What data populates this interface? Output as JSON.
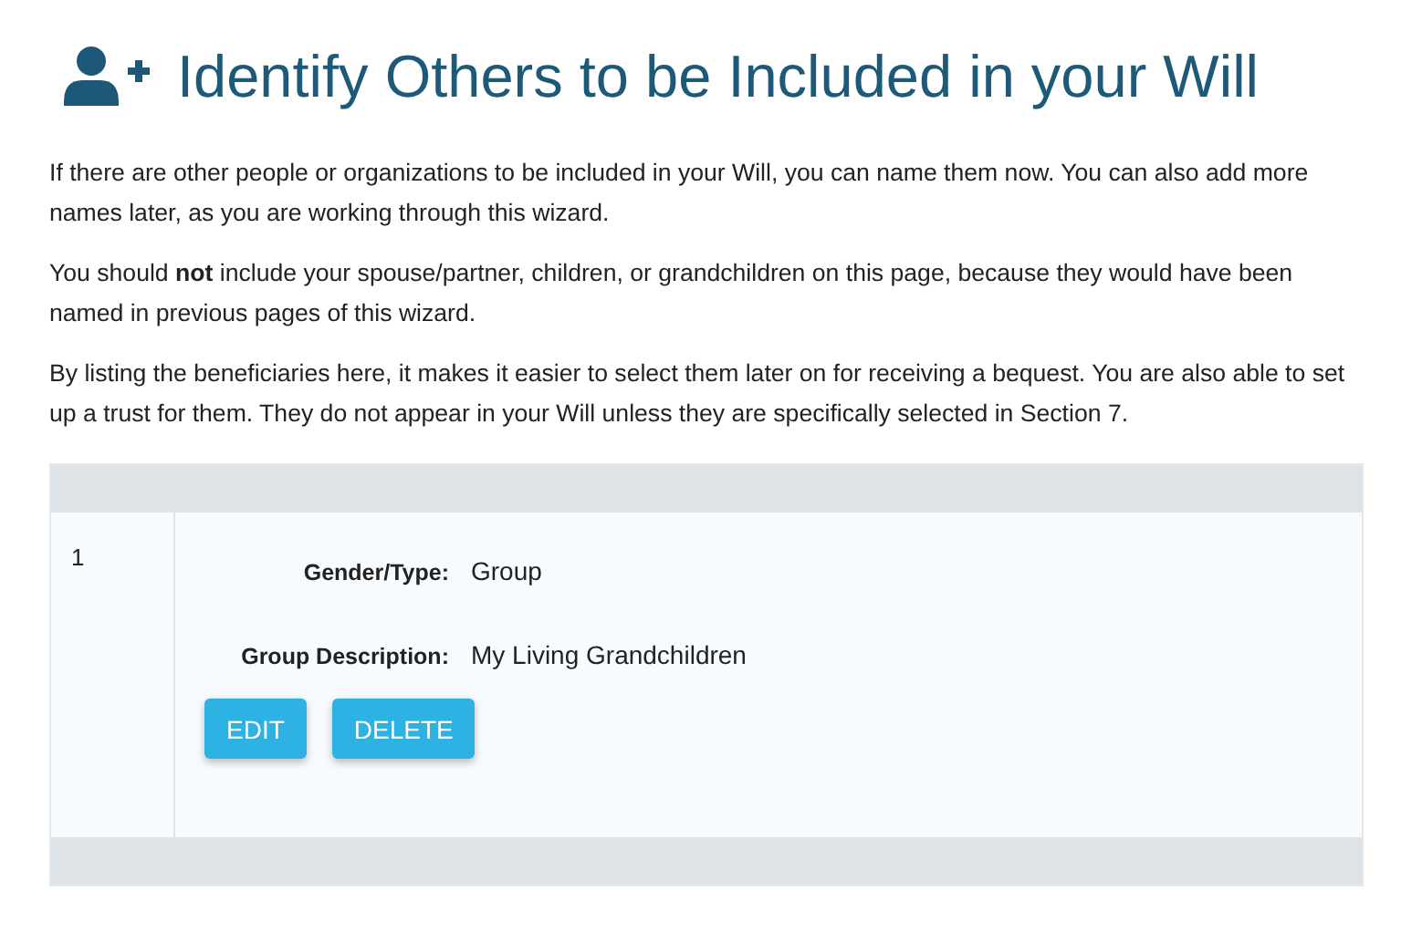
{
  "title": "Identify Others to be Included in your Will",
  "paragraphs": [
    "If there are other people or organizations to be included in your Will, you can name them now. You can also add more names later, as you are working through this wizard.",
    "You should **not** include your spouse/partner, children, or grandchildren on this page, because they would have been named in previous pages of this wizard.",
    "By listing the beneficiaries here, it makes it easier to select them later on for receiving a bequest. You are also able to set up a trust for them. They do not appear in your Will unless they are specifically selected in Section 7."
  ],
  "entries": [
    {
      "number": "1",
      "fields": [
        {
          "label": "Gender/Type:",
          "value": "Group"
        },
        {
          "label": "Group Description:",
          "value": "My Living Grandchildren"
        }
      ],
      "buttons": [
        "EDIT",
        "DELETE"
      ]
    }
  ]
}
